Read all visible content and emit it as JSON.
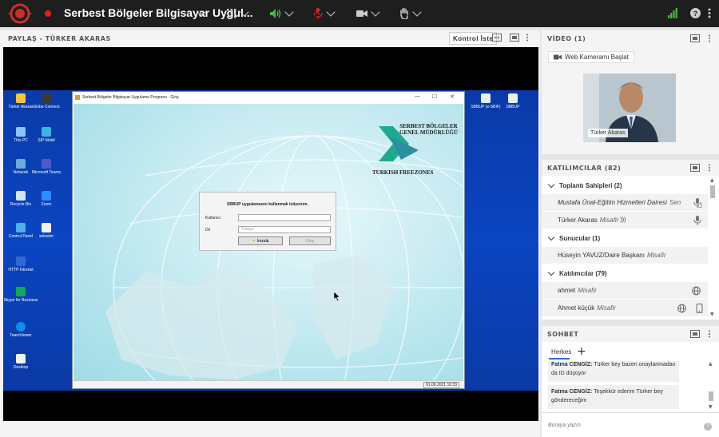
{
  "topbar": {
    "title": "Serbest Bölgeler Bilgisayar Uygul...",
    "colors": {
      "background": "#1e1e1e",
      "record": "#e2231a",
      "mic": "#44bb44",
      "mic_muted": "#e2231a",
      "signal": "#44bb44"
    }
  },
  "share": {
    "header": "PAYLAŞ - TÜRKER AKARAS",
    "control_button": "Kontrol İste"
  },
  "desktop": {
    "icons": [
      {
        "label": "Türker Akaras",
        "icon": "folder-icon"
      },
      {
        "label": "Globe Connect",
        "icon": "globe-icon"
      },
      {
        "label": "This PC",
        "icon": "computer-icon"
      },
      {
        "label": "SIP Mobil",
        "icon": "app-icon"
      },
      {
        "label": "Network",
        "icon": "network-icon"
      },
      {
        "label": "Microsoft Teams",
        "icon": "teams-icon"
      },
      {
        "label": "Recycle Bin",
        "icon": "recycle-bin-icon"
      },
      {
        "label": "Zoom",
        "icon": "zoom-icon"
      },
      {
        "label": "Control Panel",
        "icon": "control-panel-icon"
      },
      {
        "label": "sekreter",
        "icon": "document-icon"
      },
      {
        "label": "HTTP Intranet",
        "icon": "browser-icon"
      },
      {
        "label": "Skype for Business",
        "icon": "skype-icon"
      },
      {
        "label": "TeamViewer",
        "icon": "teamviewer-icon"
      },
      {
        "label": "Desktop",
        "icon": "document-icon"
      },
      {
        "label": "SBBUP (e-SBIF)",
        "icon": "app-icon"
      },
      {
        "label": "SBBUP",
        "icon": "app-icon"
      }
    ]
  },
  "app": {
    "window_title": "Serbest Bölgeler Bilgisayar Uygulama Programı - Giriş",
    "org_line1": "SERBEST BÖLGELER",
    "org_line2": "GENEL MÜDÜRLÜĞÜ",
    "org_bottom": "TURKISH FREEZONES",
    "login_prompt": "SBBUP uygulamasını kullanmak istiyorum.",
    "user_label": "Kullanıcı",
    "lang_label": "Dil",
    "lang_value": "Türkçe",
    "sign_button": "İmzala",
    "login_button": "Giriş",
    "status_date": "01.09.2021 10:33"
  },
  "video": {
    "header": "VİDEO (1)",
    "start_camera": "Web Kameramı Başlat",
    "participant": "Türker Akaras"
  },
  "attendees": {
    "header": "KATILIMCILAR (82)",
    "rows": [
      {
        "type": "group",
        "label": "Toplantı Sahipleri (2)"
      },
      {
        "type": "user",
        "name": "Mustafa Ünal-Eğitim Hizmetleri Dairesi",
        "role": "Sen",
        "icons": [
          "mic-muted-icon"
        ]
      },
      {
        "type": "user",
        "name": "Türker Akaras",
        "role": "Misafir",
        "icons": [
          "speaking-icon",
          "mic-icon"
        ]
      },
      {
        "type": "group",
        "label": "Sunucular (1)"
      },
      {
        "type": "user",
        "name": "Hüseyin YAVUZ/Daire Başkanı",
        "role": "Misafir",
        "icons": []
      },
      {
        "type": "group",
        "label": "Katılımcılar (79)"
      },
      {
        "type": "user",
        "name": "ahmet",
        "role": "Misafir",
        "icons": [
          "globe-icon"
        ]
      },
      {
        "type": "user",
        "name": "Ahmet küçük",
        "role": "Misafir",
        "icons": [
          "globe-icon",
          "phone-icon"
        ]
      }
    ]
  },
  "chat": {
    "header": "SOHBET",
    "tab": "Herkes",
    "messages": [
      {
        "sender": "Fatma CENGİZ:",
        "text": "Türker bey bazen onaylanmadan da ID düşüyor"
      },
      {
        "sender": "Fatma CENGİZ:",
        "text": "Teşekkür ederim Türker bey göndereceğim"
      }
    ],
    "input_placeholder": "Buraya yazın"
  }
}
